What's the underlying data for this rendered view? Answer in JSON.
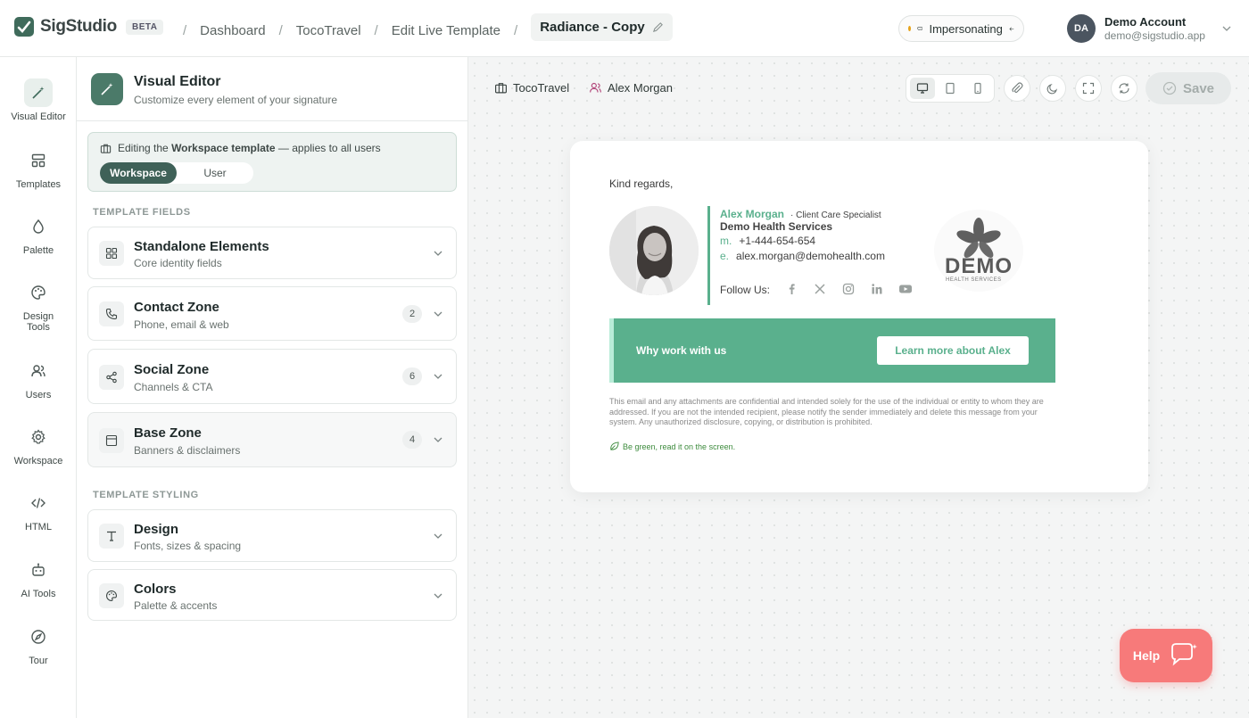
{
  "app": {
    "name": "SigStudio",
    "badge": "BETA"
  },
  "breadcrumbs": {
    "items": [
      "Dashboard",
      "TocoTravel",
      "Edit Live Template"
    ],
    "current": "Radiance - Copy"
  },
  "impersonation": {
    "label": "Impersonating",
    "status_color": "#e6a21a"
  },
  "account": {
    "initials": "DA",
    "name": "Demo Account",
    "email": "demo@sigstudio.app"
  },
  "nav": {
    "items": [
      {
        "label": "Visual Editor",
        "icon": "magic-wand-icon",
        "active": true
      },
      {
        "label": "Templates",
        "icon": "templates-icon"
      },
      {
        "label": "Palette",
        "icon": "droplet-icon"
      },
      {
        "label": "Design Tools",
        "icon": "palette-icon"
      },
      {
        "label": "Users",
        "icon": "users-icon"
      },
      {
        "label": "Workspace",
        "icon": "gear-icon"
      },
      {
        "label": "HTML",
        "icon": "code-icon"
      },
      {
        "label": "AI Tools",
        "icon": "robot-icon"
      },
      {
        "label": "Tour",
        "icon": "compass-icon"
      }
    ]
  },
  "editor": {
    "title": "Visual Editor",
    "subtitle": "Customize every element of your signature",
    "notice": {
      "prefix": "Editing the",
      "strong": "Workspace template",
      "suffix": "— applies to all users"
    },
    "toggle": {
      "workspace": "Workspace",
      "user": "User",
      "selected": "Workspace"
    },
    "fields_label": "TEMPLATE FIELDS",
    "styling_label": "TEMPLATE STYLING",
    "fields": [
      {
        "title": "Standalone Elements",
        "subtitle": "Core identity fields",
        "icon": "grid-icon",
        "count": ""
      },
      {
        "title": "Contact Zone",
        "subtitle": "Phone, email & web",
        "icon": "phone-icon",
        "count": "2"
      },
      {
        "title": "Social Zone",
        "subtitle": "Channels & CTA",
        "icon": "share-icon",
        "count": "6"
      },
      {
        "title": "Base Zone",
        "subtitle": "Banners & disclaimers",
        "icon": "layout-icon",
        "count": "4"
      }
    ],
    "styling": [
      {
        "title": "Design",
        "subtitle": "Fonts, sizes & spacing",
        "icon": "type-icon"
      },
      {
        "title": "Colors",
        "subtitle": "Palette & accents",
        "icon": "palette-icon"
      }
    ]
  },
  "preview": {
    "company": "TocoTravel",
    "user": "Alex Morgan",
    "save_label": "Save",
    "signature": {
      "greeting": "Kind regards,",
      "name": "Alex Morgan",
      "role": "Client Care Specialist",
      "company": "Demo Health Services",
      "phone_key": "m.",
      "phone": "+1-444-654-654",
      "email_key": "e.",
      "email": "alex.morgan@demohealth.com",
      "follow_label": "Follow Us:",
      "social": [
        "facebook-icon",
        "x-icon",
        "instagram-icon",
        "linkedin-icon",
        "youtube-icon"
      ],
      "logo_word": "DEMO",
      "logo_tag": "HEALTH SERVICES",
      "banner_text": "Why work with us",
      "banner_button": "Learn more about Alex",
      "disclaimer": "This email and any attachments are confidential and intended solely for the use of the individual or entity to whom they are addressed. If you are not the intended recipient, please notify the sender immediately and delete this message from your system. Any unauthorized disclosure, copying, or distribution is prohibited.",
      "green_note": "Be green, read it on the screen.",
      "accent_color": "#5ab08d"
    }
  },
  "help": {
    "label": "Help"
  }
}
